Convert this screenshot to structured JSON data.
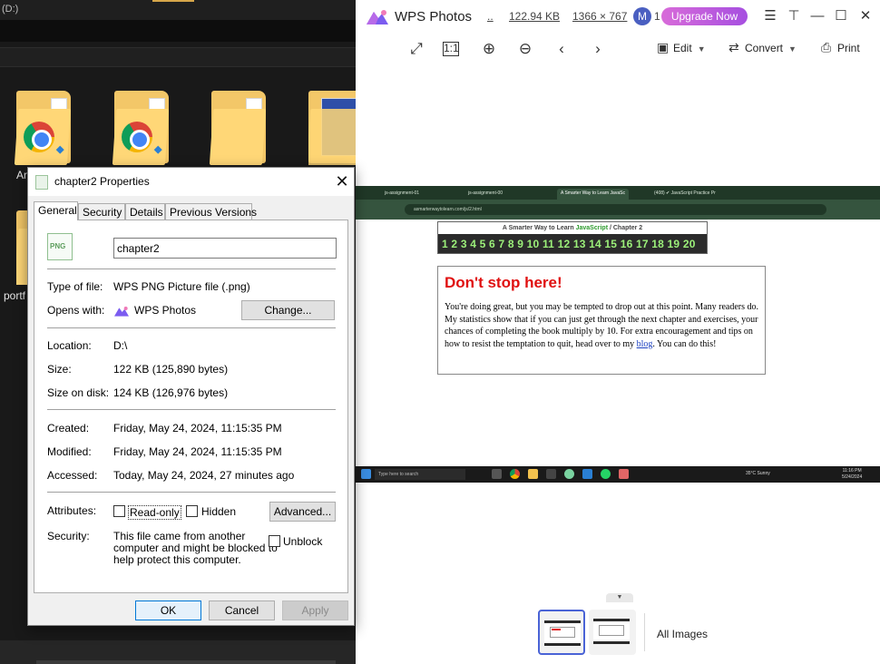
{
  "explorer": {
    "address": "(D:)",
    "folders": [
      {
        "label": "An"
      },
      {
        "label": ""
      },
      {
        "label": ""
      },
      {
        "label": ""
      },
      {
        "label": "portf"
      }
    ]
  },
  "dialog": {
    "title": "chapter2 Properties",
    "tabs": [
      "General",
      "Security",
      "Details",
      "Previous Versions"
    ],
    "file_name": "chapter2",
    "icon_text": "PNG",
    "type_label": "Type of file:",
    "type_value": "WPS PNG Picture file (.png)",
    "opens_label": "Opens with:",
    "opens_value": "WPS Photos",
    "change_button": "Change...",
    "location_label": "Location:",
    "location_value": "D:\\",
    "size_label": "Size:",
    "size_value": "122 KB (125,890 bytes)",
    "size_on_disk_label": "Size on disk:",
    "size_on_disk_value": "124 KB (126,976 bytes)",
    "created_label": "Created:",
    "created_value": "Friday, May 24, 2024, 11:15:35 PM",
    "modified_label": "Modified:",
    "modified_value": "Friday, May 24, 2024, 11:15:35 PM",
    "accessed_label": "Accessed:",
    "accessed_value": "Today, May 24, 2024, 27 minutes ago",
    "attributes_label": "Attributes:",
    "readonly_label": "Read-only",
    "hidden_label": "Hidden",
    "advanced_button": "Advanced...",
    "security_label": "Security:",
    "security_text_1": "This file came from another",
    "security_text_2": "computer and might be blocked to",
    "security_text_3": "help protect this computer.",
    "unblock_label": "Unblock",
    "ok_button": "OK",
    "cancel_button": "Cancel",
    "apply_button": "Apply"
  },
  "wps": {
    "title": "WPS Photos",
    "dots": "..",
    "file_size": "122.94 KB",
    "dimensions": "1366 × 767",
    "avatar_letter": "M",
    "avatar_count": "1",
    "upgrade": "Upgrade Now",
    "edit": "Edit",
    "convert": "Convert",
    "print": "Print",
    "all_images": "All Images",
    "accent_color": "#b455dd"
  },
  "screenshot": {
    "tabs": [
      "js-assignment-01",
      "js-assignment-00",
      "A Smarter Way to Learn JavaSc",
      "(408) ✔ JavaScript Practice Pr"
    ],
    "url": "asmarterwaytolearn.com/js/2.html",
    "book_title_prefix": "A Smarter Way to Learn ",
    "book_title_js": "JavaScript",
    "book_title_suffix": " / Chapter 2",
    "chapters": "1 2 3 4 5 6 7 8 9 10 11 12 13 14 15 16 17 18 19 20",
    "heading": "Don't stop here!",
    "paragraph_1": "You're doing great, but you may be tempted to drop out at this point. Many readers do. My statistics show that if you can just get through the next chapter and exercises, your chances of completing the book multiply by 10. For extra encouragement and tips on how to resist the temptation to quit, head over to my ",
    "blog_link": "blog",
    "paragraph_2": ". You can do this!",
    "search_placeholder": "Type here to search",
    "weather": "35°C  Sunny",
    "time": "11:16 PM",
    "date": "5/24/2024"
  }
}
